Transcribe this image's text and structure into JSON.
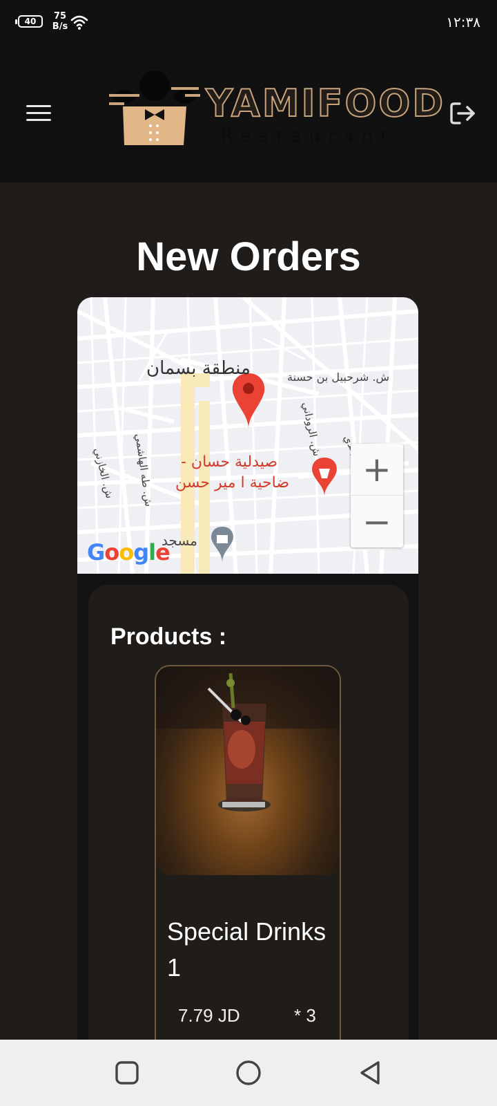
{
  "status_bar": {
    "battery": "40",
    "net_speed_value": "75",
    "net_speed_unit": "B/s",
    "time": "١٢:٣٨"
  },
  "header": {
    "logo_name": "YAMIFOOD",
    "logo_subtitle": "Restaurant",
    "menu_icon": "hamburger-menu-icon",
    "logout_icon": "logout-icon"
  },
  "page": {
    "title": "New Orders"
  },
  "map": {
    "labels": {
      "area": "منطقة بسمان",
      "street_top": "ش. شرحبيل بن حسنة",
      "street_right": "ش. مالك الرهدي",
      "street_mid": "ش. الروداني",
      "street_left1": "ش. طه الهاشمي",
      "street_left2": "ش. الخازني",
      "pharmacy_line1": "صيدلية حسان -",
      "pharmacy_line2": "ضاحية ا مير حسن",
      "mosque": "مسجد",
      "google": "Google"
    },
    "zoom_in": "+",
    "zoom_out": "−"
  },
  "products": {
    "heading": "Products :",
    "items": [
      {
        "name": "Special Drinks 1",
        "price": "7.79 JD",
        "quantity": "* 3"
      }
    ]
  },
  "colors": {
    "background": "#1f1c19",
    "header": "#111111",
    "accent_gold": "#c9a47d",
    "map_pin": "#ea4335"
  }
}
